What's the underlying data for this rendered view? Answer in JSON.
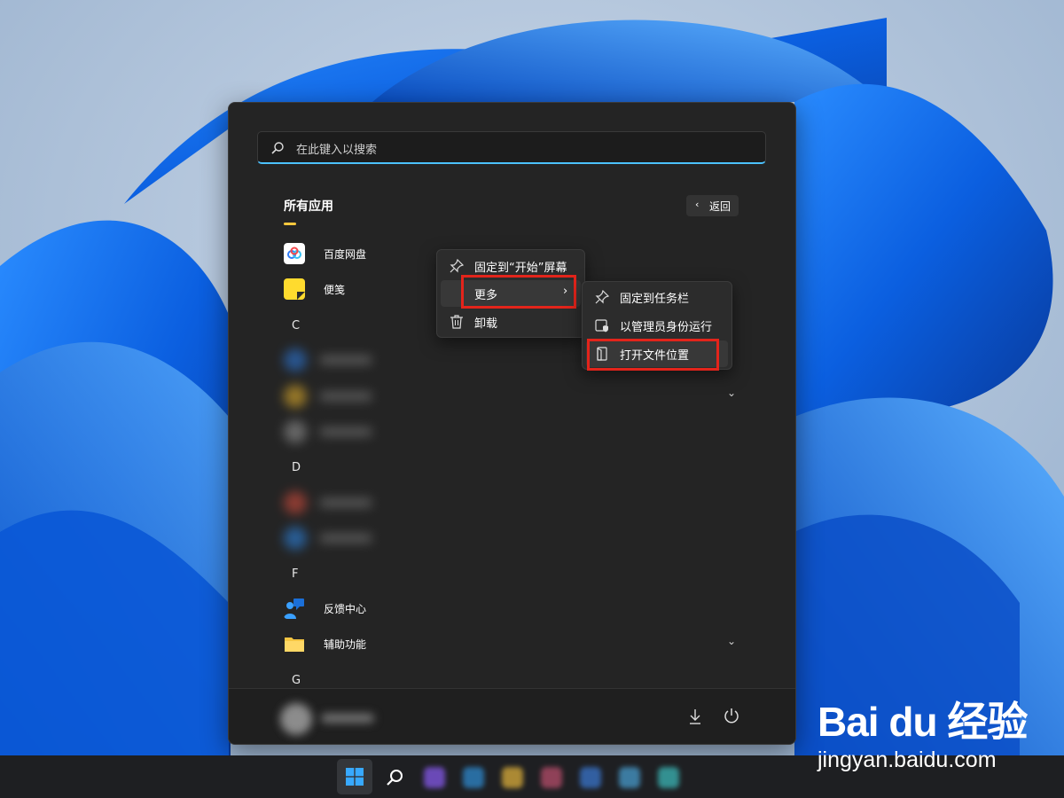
{
  "start_menu": {
    "search_placeholder": "在此键入以搜索",
    "section_title": "所有应用",
    "back_label": "返回",
    "back_chevron": "‹",
    "apps_top": [
      {
        "name": "百度网盘",
        "icon": "baidu-netdisk-icon"
      },
      {
        "name": "便笺",
        "icon": "sticky-notes-icon"
      }
    ],
    "letters": [
      "C",
      "D",
      "F",
      "G"
    ],
    "apps_f": [
      {
        "name": "反馈中心",
        "icon": "feedback-hub-icon"
      },
      {
        "name": "辅助功能",
        "icon": "folder-icon"
      }
    ],
    "expand_chevron": "⌄"
  },
  "context_menu": {
    "items": [
      {
        "label": "固定到“开始”屏幕",
        "icon": "pin-icon"
      },
      {
        "label": "更多",
        "icon": "",
        "has_submenu": true
      },
      {
        "label": "卸载",
        "icon": "trash-icon"
      }
    ],
    "submenu_arrow": "›"
  },
  "submenu": {
    "items": [
      {
        "label": "固定到任务栏",
        "icon": "pin-icon"
      },
      {
        "label": "以管理员身份运行",
        "icon": "admin-shield-icon"
      },
      {
        "label": "打开文件位置",
        "icon": "file-location-icon"
      }
    ]
  },
  "colors": {
    "accent_blue": "#4cc2ff",
    "highlight_red": "#e3241b",
    "title_underline": "#ffc83d"
  },
  "watermark": {
    "logo_text": "Bai du 经验",
    "url": "jingyan.baidu.com"
  }
}
